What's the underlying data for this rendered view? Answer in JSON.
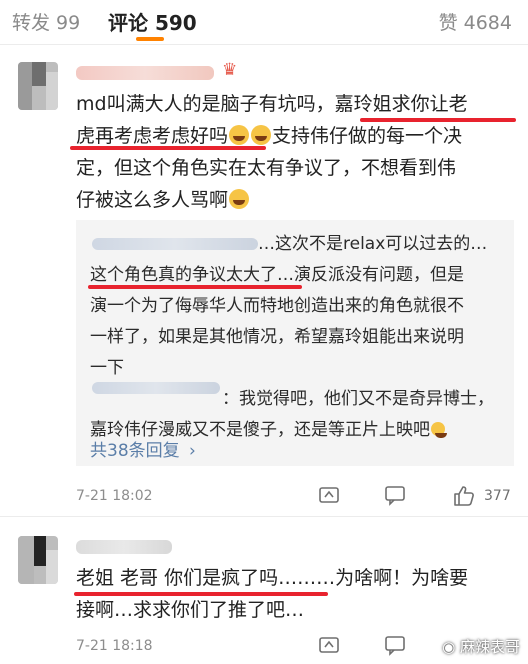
{
  "tabs": {
    "reposts": "转发 99",
    "comments": "评论 590",
    "likes": "赞 4684"
  },
  "comments": [
    {
      "lines": [
        "md叫满大人的是脑子有坑吗，嘉玲姐求你让老",
        "虎再考虑考虑好吗",
        "支持伟仔做的每一个决",
        "定，但这个角色实在太有争议了，不想看到伟",
        "仔被这么多人骂啊"
      ],
      "replies": [
        "…这次不是relax可以过去的…",
        "这个角色真的争议太大了…演反派没有问题，但是",
        "演一个为了侮辱华人而特地创造出来的角色就很不",
        "一样了，如果是其他情况，希望嘉玲姐能出来说明",
        "一下",
        "：我觉得吧，他们又不是奇异博士，",
        "嘉玲伟仔漫威又不是傻子，还是等正片上映吧"
      ],
      "reply_link": "共38条回复",
      "time": "7-21 18:02",
      "like_count": "377"
    },
    {
      "lines": [
        "老姐 老哥 你们是疯了吗………为啥啊！为啥要",
        "接啊…求求你们了推了吧…"
      ],
      "time": "7-21 18:18"
    }
  ],
  "watermark": "麻辣表哥"
}
